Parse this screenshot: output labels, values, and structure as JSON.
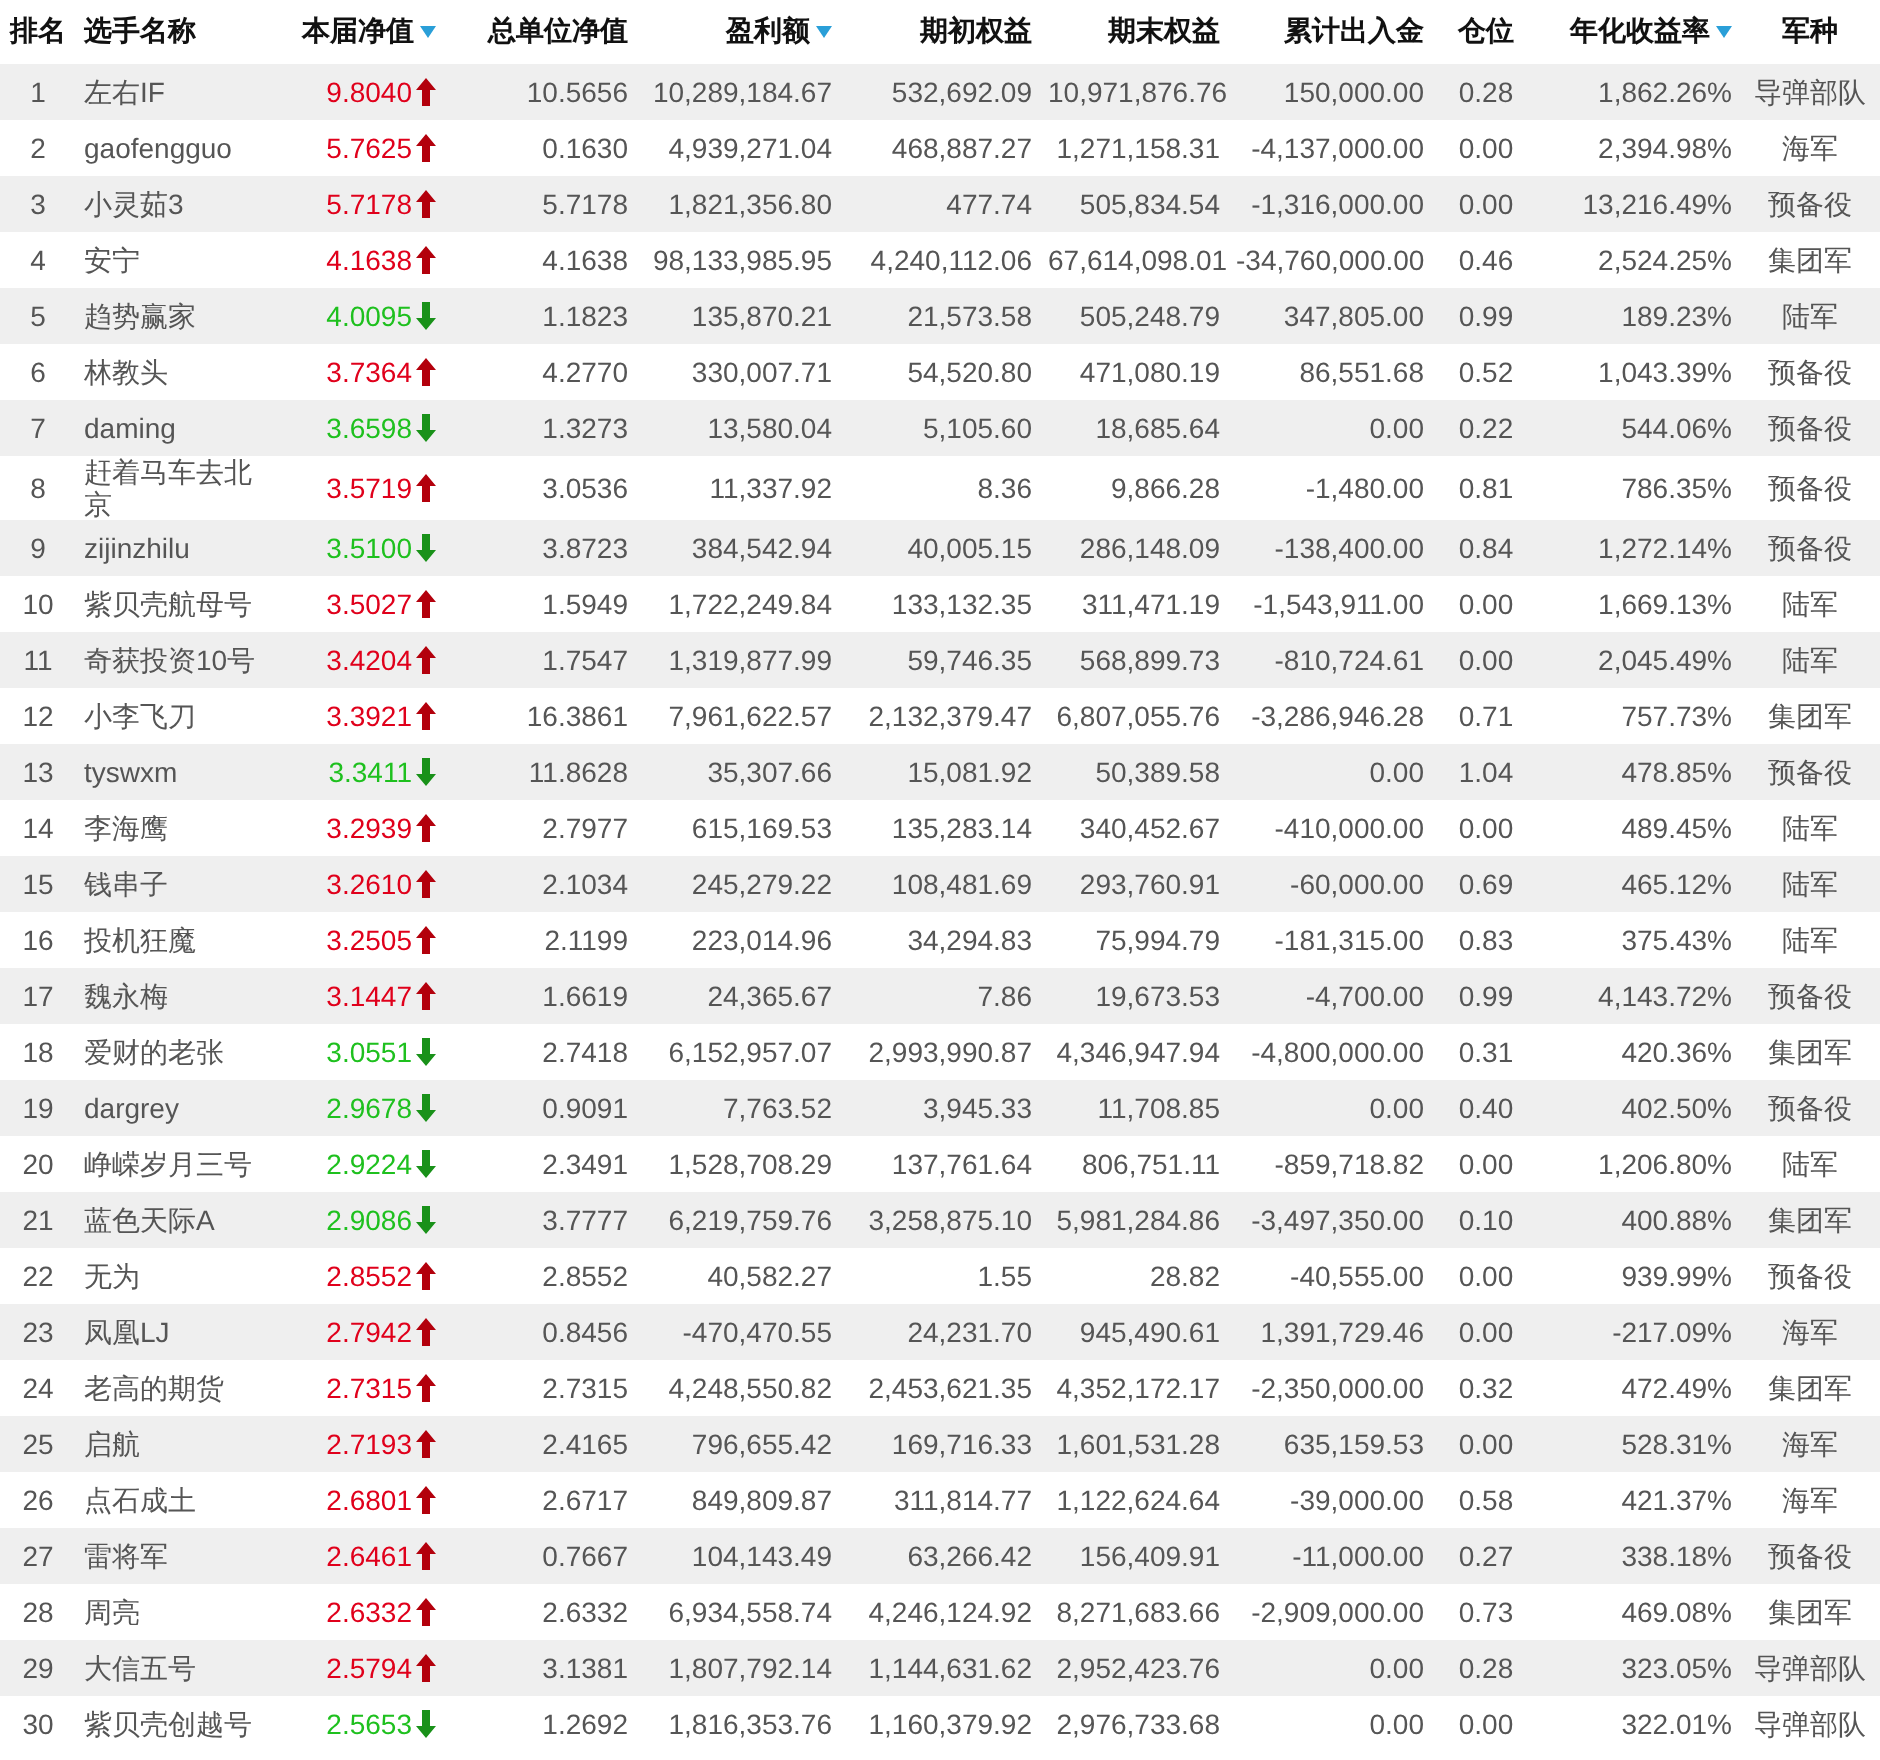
{
  "table": {
    "columns": [
      {
        "label": "排名",
        "sorted": false
      },
      {
        "label": "选手名称",
        "sorted": false
      },
      {
        "label": "本届净值",
        "sorted": true
      },
      {
        "label": "总单位净值",
        "sorted": false
      },
      {
        "label": "盈利额",
        "sorted": true
      },
      {
        "label": "期初权益",
        "sorted": false
      },
      {
        "label": "期末权益",
        "sorted": false
      },
      {
        "label": "累计出入金",
        "sorted": false
      },
      {
        "label": "仓位",
        "sorted": false
      },
      {
        "label": "年化收益率",
        "sorted": true
      },
      {
        "label": "军种",
        "sorted": false
      }
    ],
    "rows": [
      {
        "rising": true,
        "cells": [
          "1",
          "左右IF",
          "9.8040",
          "10.5656",
          "10,289,184.67",
          "532,692.09",
          "10,971,876.76",
          "150,000.00",
          "0.28",
          "1,862.26%",
          "导弹部队"
        ]
      },
      {
        "rising": true,
        "cells": [
          "2",
          "gaofengguo",
          "5.7625",
          "0.1630",
          "4,939,271.04",
          "468,887.27",
          "1,271,158.31",
          "-4,137,000.00",
          "0.00",
          "2,394.98%",
          "海军"
        ]
      },
      {
        "rising": true,
        "cells": [
          "3",
          "小灵茹3",
          "5.7178",
          "5.7178",
          "1,821,356.80",
          "477.74",
          "505,834.54",
          "-1,316,000.00",
          "0.00",
          "13,216.49%",
          "预备役"
        ]
      },
      {
        "rising": true,
        "cells": [
          "4",
          "安宁",
          "4.1638",
          "4.1638",
          "98,133,985.95",
          "4,240,112.06",
          "67,614,098.01",
          "-34,760,000.00",
          "0.46",
          "2,524.25%",
          "集团军"
        ]
      },
      {
        "rising": false,
        "cells": [
          "5",
          "趋势赢家",
          "4.0095",
          "1.1823",
          "135,870.21",
          "21,573.58",
          "505,248.79",
          "347,805.00",
          "0.99",
          "189.23%",
          "陆军"
        ]
      },
      {
        "rising": true,
        "cells": [
          "6",
          "林教头",
          "3.7364",
          "4.2770",
          "330,007.71",
          "54,520.80",
          "471,080.19",
          "86,551.68",
          "0.52",
          "1,043.39%",
          "预备役"
        ]
      },
      {
        "rising": false,
        "cells": [
          "7",
          "daming",
          "3.6598",
          "1.3273",
          "13,580.04",
          "5,105.60",
          "18,685.64",
          "0.00",
          "0.22",
          "544.06%",
          "预备役"
        ]
      },
      {
        "rising": true,
        "cells": [
          "8",
          "赶着马车去北京",
          "3.5719",
          "3.0536",
          "11,337.92",
          "8.36",
          "9,866.28",
          "-1,480.00",
          "0.81",
          "786.35%",
          "预备役"
        ]
      },
      {
        "rising": false,
        "cells": [
          "9",
          "zijinzhilu",
          "3.5100",
          "3.8723",
          "384,542.94",
          "40,005.15",
          "286,148.09",
          "-138,400.00",
          "0.84",
          "1,272.14%",
          "预备役"
        ]
      },
      {
        "rising": true,
        "cells": [
          "10",
          "紫贝壳航母号",
          "3.5027",
          "1.5949",
          "1,722,249.84",
          "133,132.35",
          "311,471.19",
          "-1,543,911.00",
          "0.00",
          "1,669.13%",
          "陆军"
        ]
      },
      {
        "rising": true,
        "cells": [
          "11",
          "奇获投资10号",
          "3.4204",
          "1.7547",
          "1,319,877.99",
          "59,746.35",
          "568,899.73",
          "-810,724.61",
          "0.00",
          "2,045.49%",
          "陆军"
        ]
      },
      {
        "rising": true,
        "cells": [
          "12",
          "小李飞刀",
          "3.3921",
          "16.3861",
          "7,961,622.57",
          "2,132,379.47",
          "6,807,055.76",
          "-3,286,946.28",
          "0.71",
          "757.73%",
          "集团军"
        ]
      },
      {
        "rising": false,
        "cells": [
          "13",
          "tyswxm",
          "3.3411",
          "11.8628",
          "35,307.66",
          "15,081.92",
          "50,389.58",
          "0.00",
          "1.04",
          "478.85%",
          "预备役"
        ]
      },
      {
        "rising": true,
        "cells": [
          "14",
          "李海鹰",
          "3.2939",
          "2.7977",
          "615,169.53",
          "135,283.14",
          "340,452.67",
          "-410,000.00",
          "0.00",
          "489.45%",
          "陆军"
        ]
      },
      {
        "rising": true,
        "cells": [
          "15",
          "钱串子",
          "3.2610",
          "2.1034",
          "245,279.22",
          "108,481.69",
          "293,760.91",
          "-60,000.00",
          "0.69",
          "465.12%",
          "陆军"
        ]
      },
      {
        "rising": true,
        "cells": [
          "16",
          "投机狂魔",
          "3.2505",
          "2.1199",
          "223,014.96",
          "34,294.83",
          "75,994.79",
          "-181,315.00",
          "0.83",
          "375.43%",
          "陆军"
        ]
      },
      {
        "rising": true,
        "cells": [
          "17",
          "魏永梅",
          "3.1447",
          "1.6619",
          "24,365.67",
          "7.86",
          "19,673.53",
          "-4,700.00",
          "0.99",
          "4,143.72%",
          "预备役"
        ]
      },
      {
        "rising": false,
        "cells": [
          "18",
          "爱财的老张",
          "3.0551",
          "2.7418",
          "6,152,957.07",
          "2,993,990.87",
          "4,346,947.94",
          "-4,800,000.00",
          "0.31",
          "420.36%",
          "集团军"
        ]
      },
      {
        "rising": false,
        "cells": [
          "19",
          "dargrey",
          "2.9678",
          "0.9091",
          "7,763.52",
          "3,945.33",
          "11,708.85",
          "0.00",
          "0.40",
          "402.50%",
          "预备役"
        ]
      },
      {
        "rising": false,
        "cells": [
          "20",
          "峥嵘岁月三号",
          "2.9224",
          "2.3491",
          "1,528,708.29",
          "137,761.64",
          "806,751.11",
          "-859,718.82",
          "0.00",
          "1,206.80%",
          "陆军"
        ]
      },
      {
        "rising": false,
        "cells": [
          "21",
          "蓝色天际A",
          "2.9086",
          "3.7777",
          "6,219,759.76",
          "3,258,875.10",
          "5,981,284.86",
          "-3,497,350.00",
          "0.10",
          "400.88%",
          "集团军"
        ]
      },
      {
        "rising": true,
        "cells": [
          "22",
          "无为",
          "2.8552",
          "2.8552",
          "40,582.27",
          "1.55",
          "28.82",
          "-40,555.00",
          "0.00",
          "939.99%",
          "预备役"
        ]
      },
      {
        "rising": true,
        "cells": [
          "23",
          "凤凰LJ",
          "2.7942",
          "0.8456",
          "-470,470.55",
          "24,231.70",
          "945,490.61",
          "1,391,729.46",
          "0.00",
          "-217.09%",
          "海军"
        ]
      },
      {
        "rising": true,
        "cells": [
          "24",
          "老高的期货",
          "2.7315",
          "2.7315",
          "4,248,550.82",
          "2,453,621.35",
          "4,352,172.17",
          "-2,350,000.00",
          "0.32",
          "472.49%",
          "集团军"
        ]
      },
      {
        "rising": true,
        "cells": [
          "25",
          "启航",
          "2.7193",
          "2.4165",
          "796,655.42",
          "169,716.33",
          "1,601,531.28",
          "635,159.53",
          "0.00",
          "528.31%",
          "海军"
        ]
      },
      {
        "rising": true,
        "cells": [
          "26",
          "点石成土",
          "2.6801",
          "2.6717",
          "849,809.87",
          "311,814.77",
          "1,122,624.64",
          "-39,000.00",
          "0.58",
          "421.37%",
          "海军"
        ]
      },
      {
        "rising": true,
        "cells": [
          "27",
          "雷将军",
          "2.6461",
          "0.7667",
          "104,143.49",
          "63,266.42",
          "156,409.91",
          "-11,000.00",
          "0.27",
          "338.18%",
          "预备役"
        ]
      },
      {
        "rising": true,
        "cells": [
          "28",
          "周亮",
          "2.6332",
          "2.6332",
          "6,934,558.74",
          "4,246,124.92",
          "8,271,683.66",
          "-2,909,000.00",
          "0.73",
          "469.08%",
          "集团军"
        ]
      },
      {
        "rising": true,
        "cells": [
          "29",
          "大信五号",
          "2.5794",
          "3.1381",
          "1,807,792.14",
          "1,144,631.62",
          "2,952,423.76",
          "0.00",
          "0.28",
          "323.05%",
          "导弹部队"
        ]
      },
      {
        "rising": false,
        "cells": [
          "30",
          "紫贝壳创越号",
          "2.5653",
          "1.2692",
          "1,816,353.76",
          "1,160,379.92",
          "2,976,733.68",
          "0.00",
          "0.00",
          "322.01%",
          "导弹部队"
        ]
      }
    ]
  }
}
